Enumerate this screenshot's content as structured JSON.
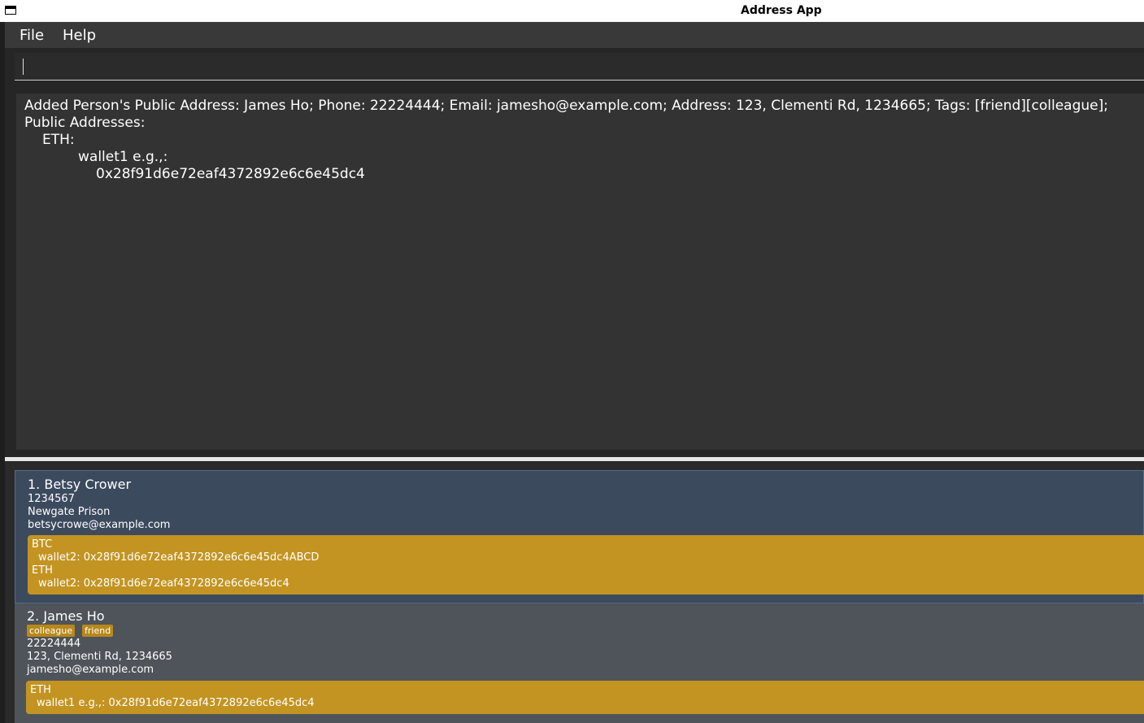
{
  "window": {
    "title": "Address App"
  },
  "menu": {
    "file": "File",
    "help": "Help"
  },
  "command": {
    "value": ""
  },
  "result": {
    "lines": [
      "Added Person's Public Address: James Ho; Phone: 22224444; Email: jamesho@example.com; Address: 123, Clementi Rd, 1234665; Tags: [friend][colleague];",
      "Public Addresses:",
      "ETH:",
      "wallet1 e.g.,:",
      "0x28f91d6e72eaf4372892e6c6e45dc4"
    ]
  },
  "persons": [
    {
      "index_name": "1. Betsy Crower",
      "tags": [],
      "phone": "1234567",
      "address": "Newgate Prison",
      "email": "betsycrowe@example.com",
      "wallets": [
        "BTC",
        "wallet2: 0x28f91d6e72eaf4372892e6c6e45dc4ABCD",
        "ETH",
        "wallet2: 0x28f91d6e72eaf4372892e6c6e45dc4"
      ],
      "selected": true
    },
    {
      "index_name": "2. James Ho",
      "tags": [
        "colleague",
        "friend"
      ],
      "phone": "22224444",
      "address": "123, Clementi Rd, 1234665",
      "email": "jamesho@example.com",
      "wallets": [
        "ETH",
        "wallet1 e.g.,: 0x28f91d6e72eaf4372892e6c6e45dc4"
      ],
      "selected": false
    }
  ],
  "colors": {
    "background": "#2b2b2b",
    "selected_card": "#3c4a5e",
    "card": "#4e545a",
    "wallet_box": "#c39422",
    "tag": "#b8881a"
  }
}
